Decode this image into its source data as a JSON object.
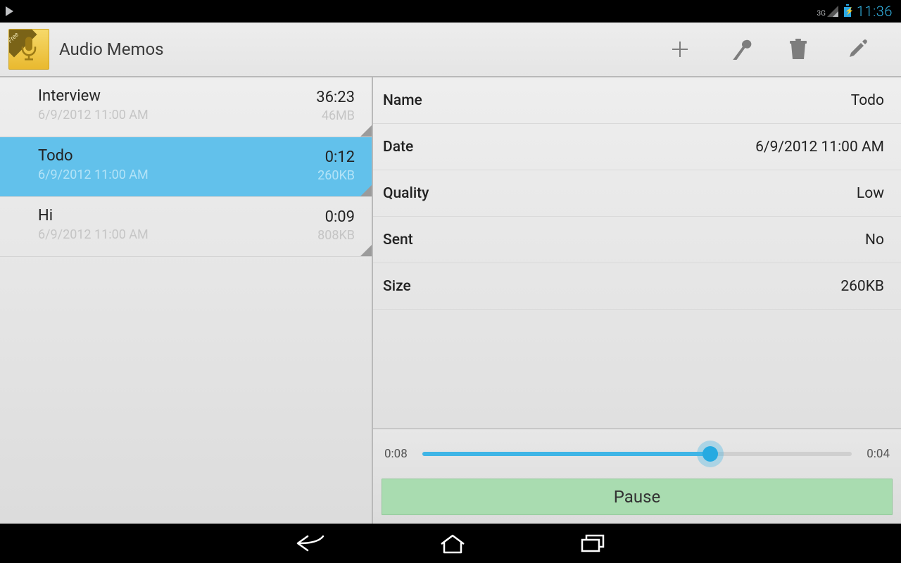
{
  "status_bar": {
    "network_label": "3G",
    "clock": "11:36"
  },
  "action_bar": {
    "title": "Audio Memos",
    "app_icon_ribbon": "Free"
  },
  "memos": [
    {
      "title": "Interview",
      "datetime": "6/9/2012 11:00 AM",
      "duration": "36:23",
      "size": "46MB",
      "selected": false
    },
    {
      "title": "Todo",
      "datetime": "6/9/2012 11:00 AM",
      "duration": "0:12",
      "size": "260KB",
      "selected": true
    },
    {
      "title": "Hi",
      "datetime": "6/9/2012 11:00 AM",
      "duration": "0:09",
      "size": "808KB",
      "selected": false
    }
  ],
  "detail": {
    "labels": {
      "name": "Name",
      "date": "Date",
      "quality": "Quality",
      "sent": "Sent",
      "size": "Size"
    },
    "name": "Todo",
    "date": "6/9/2012 11:00 AM",
    "quality": "Low",
    "sent": "No",
    "size": "260KB"
  },
  "player": {
    "elapsed": "0:08",
    "remaining": "0:04",
    "progress_percent": 67,
    "button_label": "Pause"
  }
}
